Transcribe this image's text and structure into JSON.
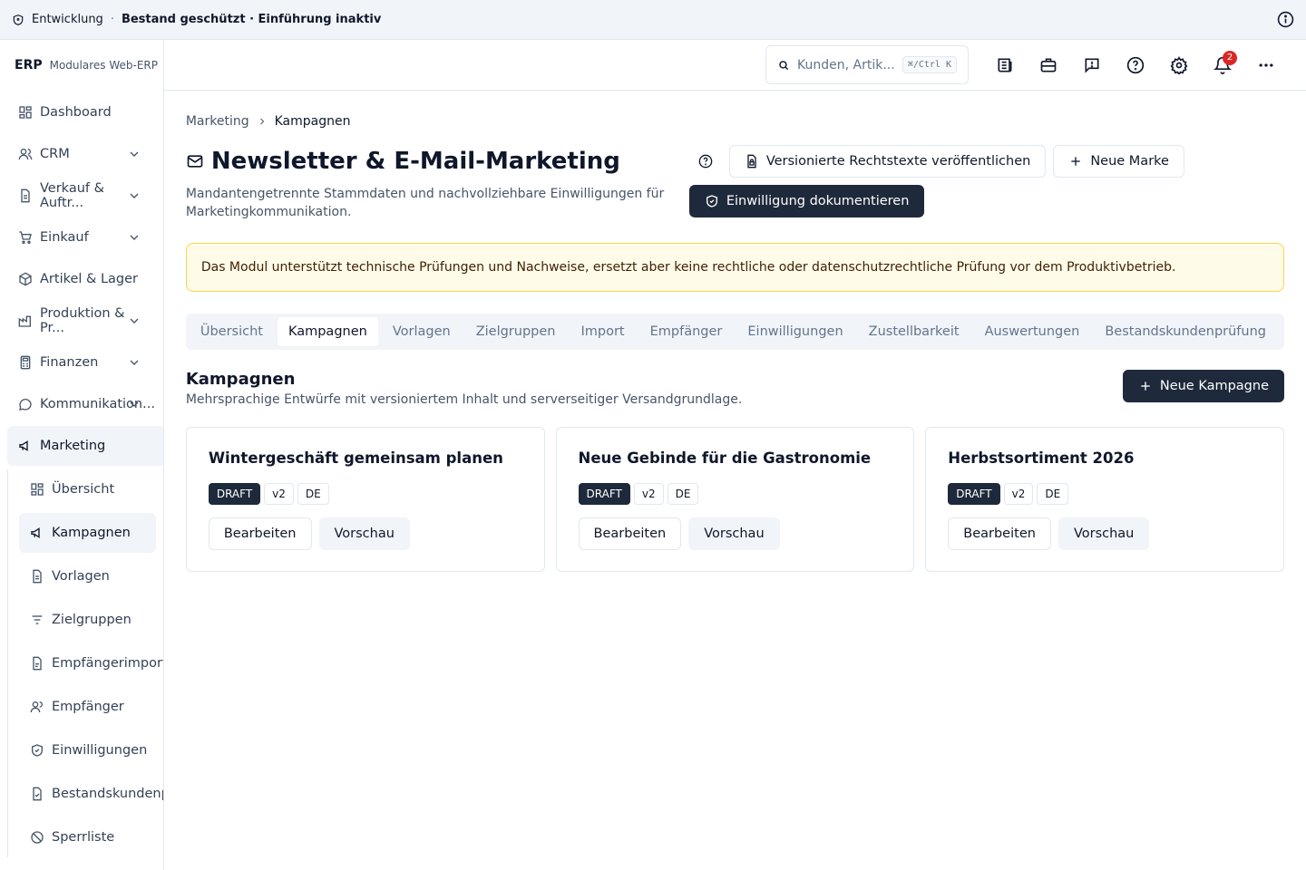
{
  "topbar": {
    "environment": "Entwicklung",
    "separator": "·",
    "status": "Bestand geschützt · Einführung inaktiv"
  },
  "brand": {
    "name": "ERP",
    "tagline": "Modulares Web-ERP"
  },
  "sidebar": {
    "items": [
      {
        "label": "Dashboard",
        "icon": "dashboard-icon"
      },
      {
        "label": "CRM",
        "icon": "users-icon"
      },
      {
        "label": "Verkauf & Auftr...",
        "icon": "document-icon"
      },
      {
        "label": "Einkauf",
        "icon": "cart-icon"
      },
      {
        "label": "Artikel & Lager",
        "icon": "package-icon"
      },
      {
        "label": "Produktion & Pr...",
        "icon": "factory-icon"
      },
      {
        "label": "Finanzen",
        "icon": "calculator-icon"
      },
      {
        "label": "Kommunikation...",
        "icon": "message-icon"
      },
      {
        "label": "Marketing",
        "icon": "megaphone-icon"
      }
    ],
    "sub_items": [
      {
        "label": "Übersicht",
        "icon": "dashboard-icon"
      },
      {
        "label": "Kampagnen",
        "icon": "megaphone-icon"
      },
      {
        "label": "Vorlagen",
        "icon": "document-icon"
      },
      {
        "label": "Zielgruppen",
        "icon": "filter-icon"
      },
      {
        "label": "Empfängerimport",
        "icon": "import-icon"
      },
      {
        "label": "Empfänger",
        "icon": "users-icon"
      },
      {
        "label": "Einwilligungen",
        "icon": "shield-icon"
      },
      {
        "label": "Bestandskundenprüf...",
        "icon": "file-check-icon"
      },
      {
        "label": "Sperrliste",
        "icon": "ban-icon"
      }
    ]
  },
  "header": {
    "search_placeholder": "Kunden, Artik...",
    "shortcut": "⌘/Ctrl K",
    "notification_count": "2"
  },
  "breadcrumb": {
    "parent": "Marketing",
    "current": "Kampagnen"
  },
  "page": {
    "title": "Newsletter & E-Mail-Marketing",
    "subtitle": "Mandantengetrennte Stammdaten und nachvollziehbare Einwilligungen für Marketingkommunikation.",
    "btn_publish": "Versionierte Rechtstexte veröffentlichen",
    "btn_new_brand": "Neue Marke",
    "btn_consent": "Einwilligung dokumentieren"
  },
  "alert": {
    "text": "Das Modul unterstützt technische Prüfungen und Nachweise, ersetzt aber keine rechtliche oder datenschutzrechtliche Prüfung vor dem Produktivbetrieb."
  },
  "tabs": [
    "Übersicht",
    "Kampagnen",
    "Vorlagen",
    "Zielgruppen",
    "Import",
    "Empfänger",
    "Einwilligungen",
    "Zustellbarkeit",
    "Auswertungen",
    "Bestandskundenprüfung"
  ],
  "section": {
    "title": "Kampagnen",
    "subtitle": "Mehrsprachige Entwürfe mit versioniertem Inhalt und serverseitiger Versandgrundlage.",
    "btn_new": "Neue Kampagne"
  },
  "campaigns": [
    {
      "title": "Wintergeschäft gemeinsam planen",
      "status": "DRAFT",
      "version": "v2",
      "lang": "DE",
      "edit": "Bearbeiten",
      "preview": "Vorschau"
    },
    {
      "title": "Neue Gebinde für die Gastronomie",
      "status": "DRAFT",
      "version": "v2",
      "lang": "DE",
      "edit": "Bearbeiten",
      "preview": "Vorschau"
    },
    {
      "title": "Herbstsortiment 2026",
      "status": "DRAFT",
      "version": "v2",
      "lang": "DE",
      "edit": "Bearbeiten",
      "preview": "Vorschau"
    }
  ],
  "colors": {
    "primary": "#1e293b",
    "alert_bg": "#fefce8",
    "alert_border": "#fcd34d",
    "badge": "#dc2626"
  }
}
